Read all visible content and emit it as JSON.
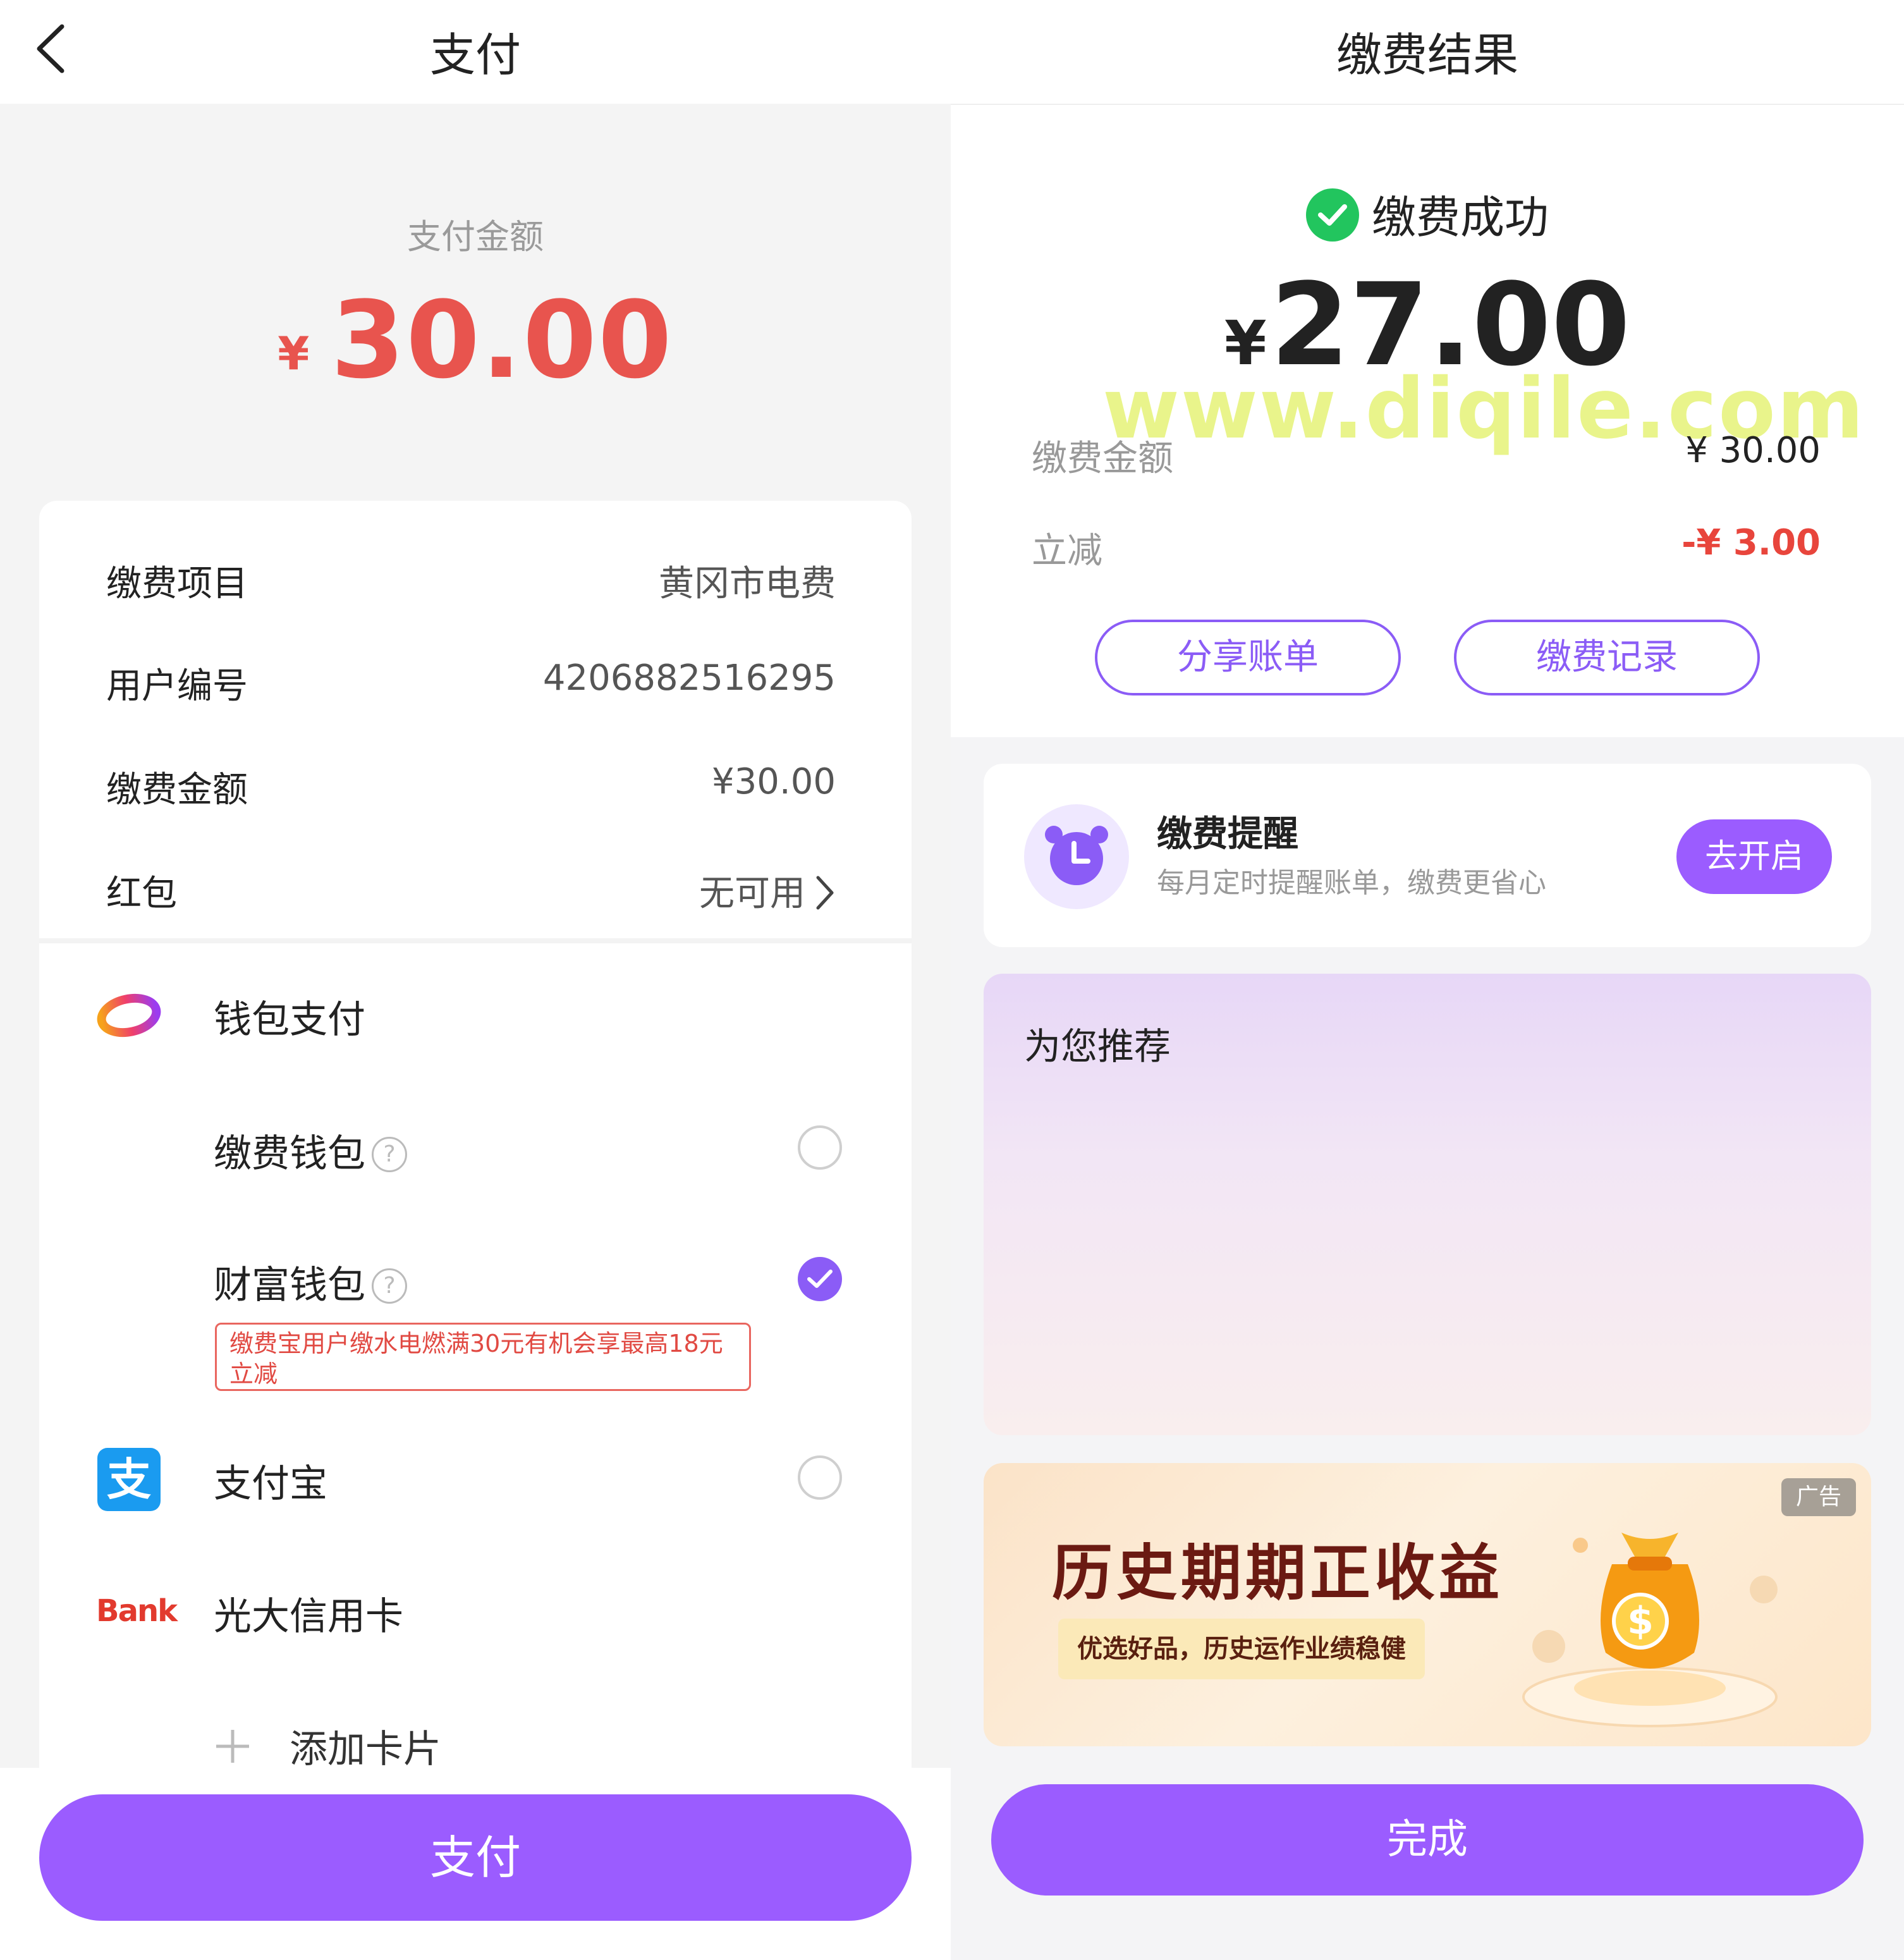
{
  "left": {
    "title": "支付",
    "amount_label": "支付金额",
    "amount_currency": "¥",
    "amount_value": "30.00",
    "details": [
      {
        "key": "缴费项目",
        "value": "黄冈市电费"
      },
      {
        "key": "用户编号",
        "value": "4206882516295"
      },
      {
        "key": "缴费金额",
        "value": "¥30.00"
      },
      {
        "key": "红包",
        "value": "无可用"
      }
    ],
    "payment_methods": {
      "wallet_pay": "钱包支付",
      "fee_wallet": "缴费钱包",
      "fortune_wallet": "财富钱包",
      "promo_text": "缴费宝用户缴水电燃满30元有机会享最高18元立减",
      "alipay": "支付宝",
      "bank_icon_text": "Bank",
      "bank_card": "光大信用卡",
      "add_card": "添加卡片"
    },
    "pay_button": "支付"
  },
  "right": {
    "title": "缴费结果",
    "status": "缴费成功",
    "paid_currency": "¥",
    "paid_value": "27.00",
    "watermark": "www.diqile.com",
    "fee_label": "缴费金额",
    "fee_value": "¥ 30.00",
    "discount_label": "立减",
    "discount_value": "-¥ 3.00",
    "share_button": "分享账单",
    "records_button": "缴费记录",
    "reminder": {
      "title": "缴费提醒",
      "subtitle": "每月定时提醒账单，缴费更省心",
      "button": "去开启"
    },
    "recommend_title": "为您推荐",
    "ad": {
      "tag": "广告",
      "title": "历史期期正收益",
      "subtitle": "优选好品，历史运作业绩稳健"
    },
    "done_button": "完成"
  },
  "colors": {
    "accent": "#9b5cff",
    "amount_red": "#e8544e",
    "success_green": "#22c55e"
  }
}
